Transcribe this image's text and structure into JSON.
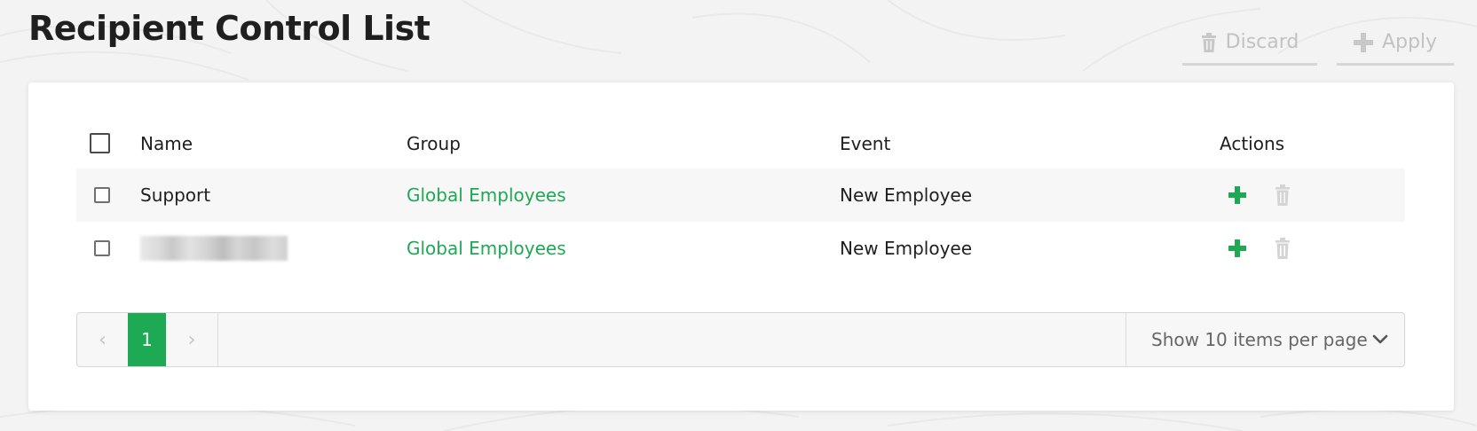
{
  "page": {
    "title": "Recipient Control List"
  },
  "toolbar": {
    "discard_label": "Discard",
    "discard_icon": "trash-icon",
    "apply_label": "Apply",
    "apply_icon": "plus-icon"
  },
  "table": {
    "columns": [
      "Name",
      "Group",
      "Event",
      "Actions"
    ],
    "rows": [
      {
        "name": "Support",
        "group": "Global Employees",
        "event": "New Employee",
        "name_redacted": false
      },
      {
        "name": "",
        "group": "Global Employees",
        "event": "New Employee",
        "name_redacted": true
      }
    ],
    "row_actions": [
      "plus-icon",
      "trash-icon"
    ]
  },
  "pagination": {
    "prev_glyph": "‹",
    "current_page": "1",
    "next_glyph": "›",
    "page_size_label": "Show 10 items per page",
    "page_size_icon": "chevron-down-icon"
  },
  "colors": {
    "accent": "#1ea954",
    "disabled": "#c4c4c4",
    "title": "#1f1f1f"
  }
}
